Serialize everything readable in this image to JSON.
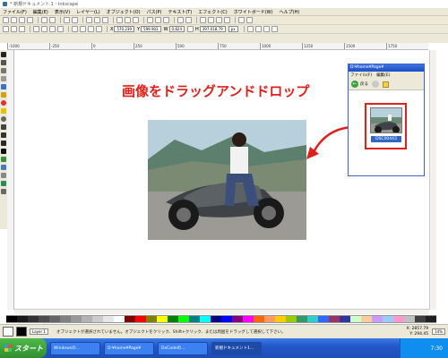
{
  "window": {
    "title": "* 新規ドキュメント 1 - Inkscape"
  },
  "menubar": {
    "items": [
      "ファイル(F)",
      "編集(E)",
      "表示(V)",
      "レイヤー(L)",
      "オブジェクト(O)",
      "パス(P)",
      "テキスト(T)",
      "エフェクト(C)",
      "ホワイトボード(W)",
      "ヘルプ(H)"
    ]
  },
  "toolbar": {
    "x_label": "X",
    "x_value": "570.239",
    "y_label": "Y",
    "y_value": "599.903",
    "w_label": "W",
    "w_value": "0.824",
    "h_label": "H",
    "h_value": "397.018.79",
    "unit": "px"
  },
  "ruler": {
    "ticks": [
      "-1000",
      "-250",
      "0",
      "250",
      "500",
      "750",
      "1000",
      "1250",
      "1500",
      "1750"
    ]
  },
  "canvas": {
    "annotation": "画像をドラッグアンドドロップ"
  },
  "explorer": {
    "title": "D:¥home¥Page¥",
    "menu": [
      "ファイル(F)",
      "編集(E)"
    ],
    "back_label": "戻る",
    "thumb_label": "DSC00443"
  },
  "palette": {
    "colors": [
      "#000000",
      "#1a1a1a",
      "#333333",
      "#4d4d4d",
      "#666666",
      "#808080",
      "#999999",
      "#b3b3b3",
      "#cccccc",
      "#e6e6e6",
      "#ffffff",
      "#800000",
      "#ff0000",
      "#808000",
      "#ffff00",
      "#008000",
      "#00ff00",
      "#008080",
      "#00ffff",
      "#000080",
      "#0000ff",
      "#800080",
      "#ff00ff",
      "#ff6600",
      "#ff9966",
      "#ffcc00",
      "#99cc00",
      "#339966",
      "#33cccc",
      "#3366ff",
      "#993366",
      "#333399",
      "#ccffcc",
      "#ffcc99",
      "#cc99ff",
      "#99ccff",
      "#ff99cc",
      "#c0c0c0",
      "#404040",
      "#202020"
    ]
  },
  "statusbar": {
    "layer": "Layer 1",
    "message": "オブジェクトが選択されていません。オブジェクトをクリック、Shift+クリック、または周囲をドラッグして選択して下さい。",
    "coord_x": "X: 2857.79",
    "coord_y": "Y: 294.45",
    "zoom": "14%"
  },
  "taskbar": {
    "start_label": "スタート",
    "tasks": [
      "Windowsの...",
      "D:¥home¥Page¥",
      "DxCodeの...",
      "新規ドキュメント1..."
    ],
    "clock": "7:30"
  }
}
